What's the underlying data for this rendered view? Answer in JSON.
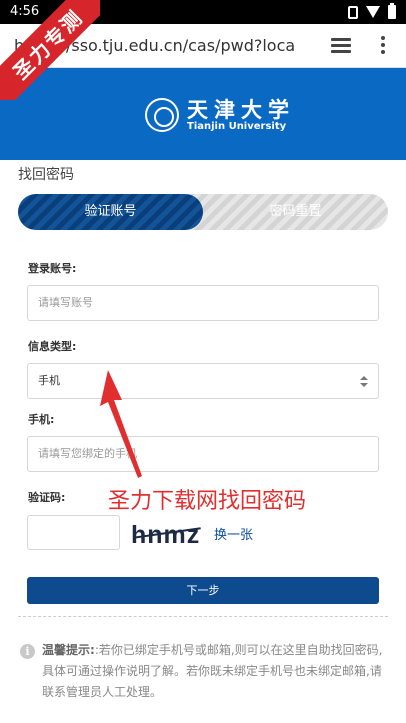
{
  "status_bar": {
    "time": "4:56"
  },
  "browser": {
    "url": "https://sso.tju.edu.cn/cas/pwd?loca"
  },
  "watermark": {
    "ribbon_text": "圣力专测",
    "overlay_text": "圣力下载网找回密码"
  },
  "header": {
    "university_cn": "天津大学",
    "university_en": "Tianjin University"
  },
  "page": {
    "title": "找回密码"
  },
  "tabs": [
    {
      "label": "验证账号",
      "active": true
    },
    {
      "label": "密码重置",
      "active": false
    }
  ],
  "form": {
    "account_label": "登录账号:",
    "account_placeholder": "请填写账号",
    "info_type_label": "信息类型:",
    "info_type_value": "手机",
    "phone_label": "手机:",
    "phone_placeholder": "请填写您绑定的手机",
    "captcha_label": "验证码:",
    "captcha_image_text": "hnmz",
    "captcha_refresh": "换一张",
    "next_button": "下一步"
  },
  "tip": {
    "title": "温馨提示:",
    "body": ":若你已绑定手机号或邮箱,则可以在这里自助找回密码,具体可通过操作说明了解。若你既未绑定手机号也未绑定邮箱,请联系管理员人工处理。"
  },
  "colors": {
    "header_blue": "#0a69c2",
    "tab_active": "#0a3f7c",
    "button": "#0d4a8e",
    "overlay_red": "#e12f2f"
  }
}
